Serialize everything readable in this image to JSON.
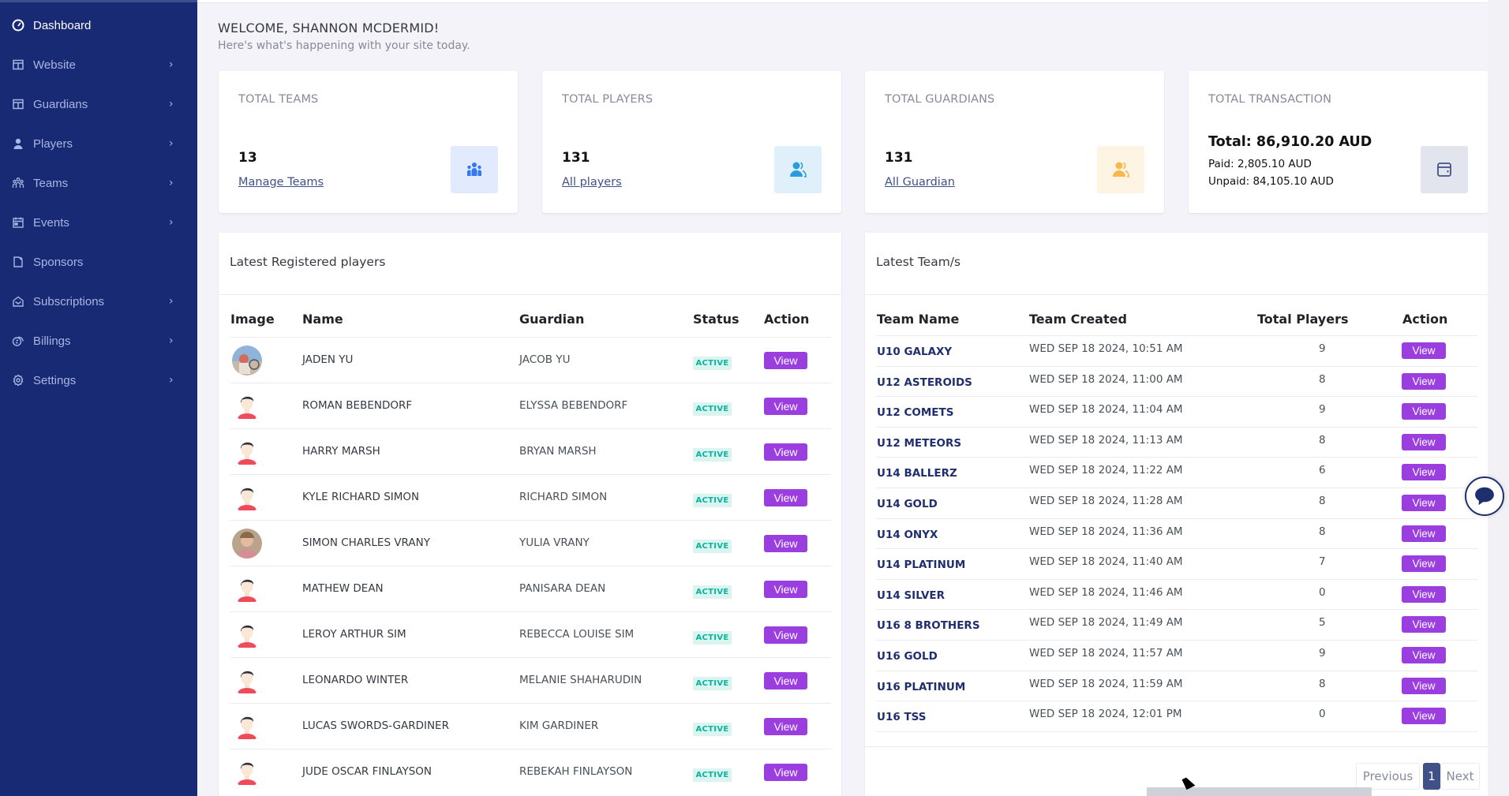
{
  "sidebar": {
    "items": [
      {
        "label": "Dashboard",
        "icon": "dashboard-icon",
        "active": true,
        "has_chevron": false
      },
      {
        "label": "Website",
        "icon": "layout-icon",
        "has_chevron": true
      },
      {
        "label": "Guardians",
        "icon": "layout-icon",
        "has_chevron": true
      },
      {
        "label": "Players",
        "icon": "user-icon",
        "has_chevron": true
      },
      {
        "label": "Teams",
        "icon": "team-icon",
        "has_chevron": true
      },
      {
        "label": "Events",
        "icon": "calendar-icon",
        "has_chevron": true
      },
      {
        "label": "Sponsors",
        "icon": "document-icon",
        "has_chevron": false
      },
      {
        "label": "Subscriptions",
        "icon": "mail-open-icon",
        "has_chevron": true
      },
      {
        "label": "Billings",
        "icon": "coins-icon",
        "has_chevron": true
      },
      {
        "label": "Settings",
        "icon": "gear-icon",
        "has_chevron": true
      }
    ],
    "chevron": "›"
  },
  "welcome": {
    "title": "WELCOME, SHANNON MCDERMID!",
    "subtitle": "Here's what's happening with your site today."
  },
  "cards": {
    "teams": {
      "title": "TOTAL TEAMS",
      "value": "13",
      "link": "Manage Teams",
      "icon": "team-icon",
      "icon_color": "#3577f1",
      "icon_bg": "#e1ebfd"
    },
    "players": {
      "title": "TOTAL PLAYERS",
      "value": "131",
      "link": "All players",
      "icon": "users-icon",
      "icon_color": "#299cdb",
      "icon_bg": "#dff0fa"
    },
    "guardians": {
      "title": "TOTAL GUARDIANS",
      "value": "131",
      "link": "All Guardian",
      "icon": "users-icon",
      "icon_color": "#f7b84b",
      "icon_bg": "#fef4e4"
    },
    "transaction": {
      "title": "TOTAL TRANSACTION",
      "total": "Total:  86,910.20 AUD",
      "paid": "Paid: 2,805.10 AUD",
      "unpaid": "Unpaid:  84,105.10 AUD",
      "icon": "wallet-icon",
      "icon_color": "#405189",
      "icon_bg": "#e2e5ed"
    }
  },
  "players_panel": {
    "title": "Latest Registered players",
    "columns": [
      "Image",
      "Name",
      "Guardian",
      "Status",
      "Action"
    ],
    "rows": [
      {
        "name": "JADEN YU",
        "guardian": "JACOB YU",
        "status": "ACTIVE",
        "action": "View",
        "avatar": "photo-outdoor"
      },
      {
        "name": "ROMAN BEBENDORF",
        "guardian": "ELYSSA BEBENDORF",
        "status": "ACTIVE",
        "action": "View",
        "avatar": "default"
      },
      {
        "name": "HARRY MARSH",
        "guardian": "BRYAN MARSH",
        "status": "ACTIVE",
        "action": "View",
        "avatar": "default"
      },
      {
        "name": "KYLE RICHARD SIMON",
        "guardian": "RICHARD SIMON",
        "status": "ACTIVE",
        "action": "View",
        "avatar": "default"
      },
      {
        "name": "SIMON CHARLES VRANY",
        "guardian": "YULIA VRANY",
        "status": "ACTIVE",
        "action": "View",
        "avatar": "photo-portrait"
      },
      {
        "name": "MATHEW DEAN",
        "guardian": "PANISARA DEAN",
        "status": "ACTIVE",
        "action": "View",
        "avatar": "default"
      },
      {
        "name": "LEROY ARTHUR SIM",
        "guardian": "REBECCA LOUISE SIM",
        "status": "ACTIVE",
        "action": "View",
        "avatar": "default"
      },
      {
        "name": "LEONARDO WINTER",
        "guardian": "MELANIE SHAHARUDIN",
        "status": "ACTIVE",
        "action": "View",
        "avatar": "default"
      },
      {
        "name": "LUCAS SWORDS-GARDINER",
        "guardian": "KIM GARDINER",
        "status": "ACTIVE",
        "action": "View",
        "avatar": "default"
      },
      {
        "name": "JUDE OSCAR FINLAYSON",
        "guardian": "REBEKAH FINLAYSON",
        "status": "ACTIVE",
        "action": "View",
        "avatar": "default"
      }
    ]
  },
  "teams_panel": {
    "title": "Latest Team/s",
    "columns": [
      "Team Name",
      "Team Created",
      "Total Players",
      "Action"
    ],
    "rows": [
      {
        "name": "U10 GALAXY",
        "created": "WED SEP 18 2024, 10:51 AM",
        "players": "9",
        "action": "View"
      },
      {
        "name": "U12 ASTEROIDS",
        "created": "WED SEP 18 2024, 11:00 AM",
        "players": "8",
        "action": "View"
      },
      {
        "name": "U12 COMETS",
        "created": "WED SEP 18 2024, 11:04 AM",
        "players": "9",
        "action": "View"
      },
      {
        "name": "U12 METEORS",
        "created": "WED SEP 18 2024, 11:13 AM",
        "players": "8",
        "action": "View"
      },
      {
        "name": "U14 BALLERZ",
        "created": "WED SEP 18 2024, 11:22 AM",
        "players": "6",
        "action": "View"
      },
      {
        "name": "U14 GOLD",
        "created": "WED SEP 18 2024, 11:28 AM",
        "players": "8",
        "action": "View"
      },
      {
        "name": "U14 ONYX",
        "created": "WED SEP 18 2024, 11:36 AM",
        "players": "8",
        "action": "View"
      },
      {
        "name": "U14 PLATINUM",
        "created": "WED SEP 18 2024, 11:40 AM",
        "players": "7",
        "action": "View"
      },
      {
        "name": "U14 SILVER",
        "created": "WED SEP 18 2024, 11:46 AM",
        "players": "0",
        "action": "View"
      },
      {
        "name": "U16 8 BROTHERS",
        "created": "WED SEP 18 2024, 11:49 AM",
        "players": "5",
        "action": "View"
      },
      {
        "name": "U16 GOLD",
        "created": "WED SEP 18 2024, 11:57 AM",
        "players": "9",
        "action": "View"
      },
      {
        "name": "U16 PLATINUM",
        "created": "WED SEP 18 2024, 11:59 AM",
        "players": "8",
        "action": "View"
      },
      {
        "name": "U16 TSS",
        "created": "WED SEP 18 2024, 12:01 PM",
        "players": "0",
        "action": "View"
      }
    ],
    "pagination": {
      "previous": "Previous",
      "current": "1",
      "next": "Next"
    }
  },
  "colors": {
    "sidebar_bg": "#172a73",
    "primary": "#405189",
    "view_button": "#9b3ee0",
    "active_badge_bg": "#daf4f0",
    "active_badge_text": "#0ab39c",
    "team_link": "#1f2f6d"
  },
  "chat": {
    "icon": "chat-bubble-icon"
  }
}
